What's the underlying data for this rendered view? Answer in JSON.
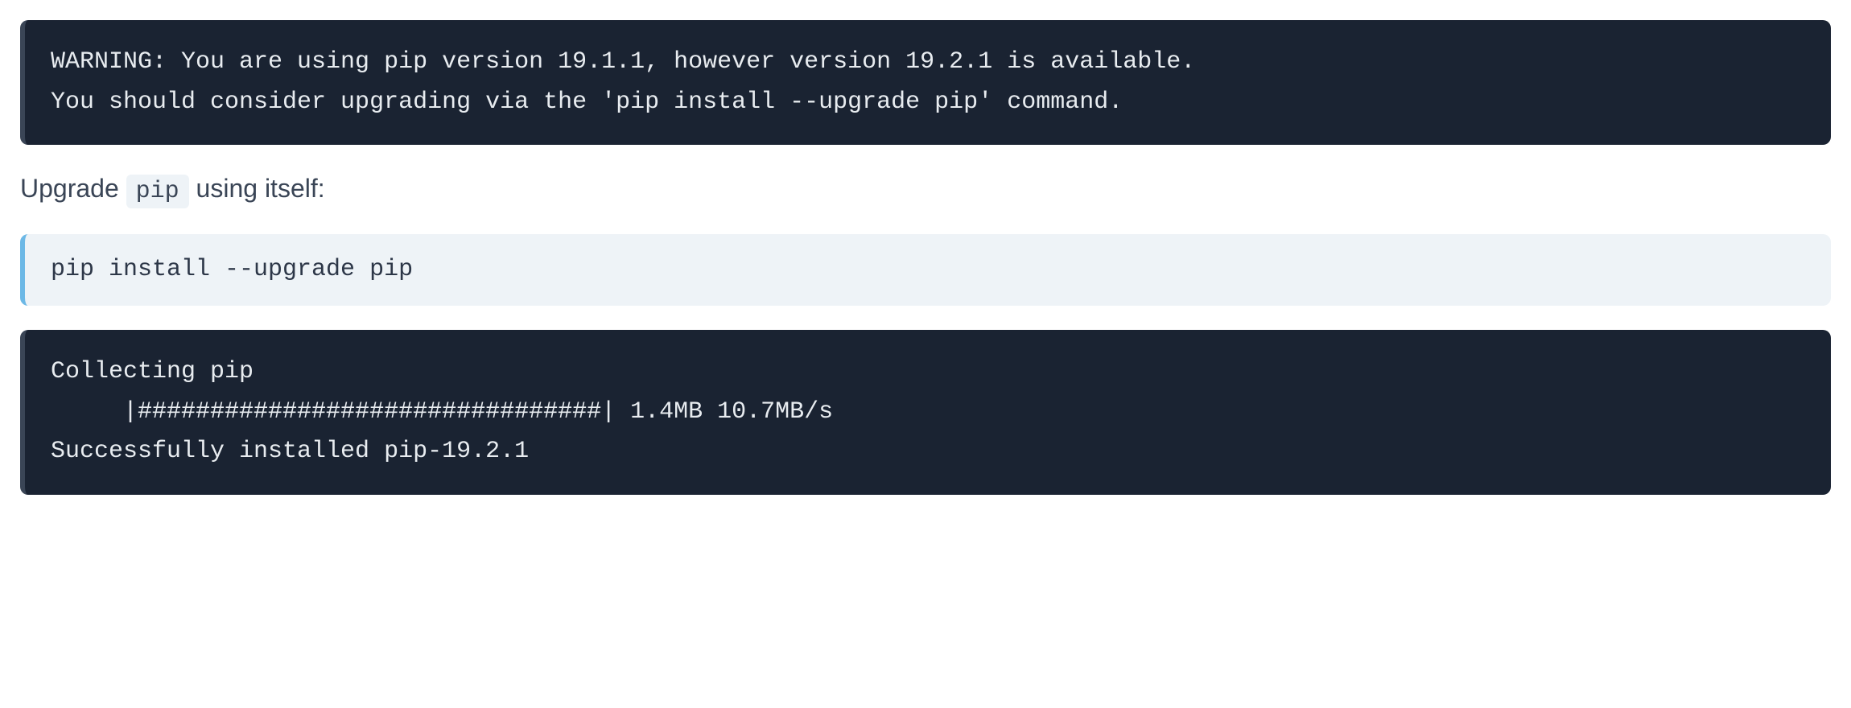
{
  "block1": "WARNING: You are using pip version 19.1.1, however version 19.2.1 is available.\nYou should consider upgrading via the 'pip install --upgrade pip' command.",
  "prose": {
    "part1": "Upgrade ",
    "code": "pip",
    "part2": " using itself:"
  },
  "block2": "pip install --upgrade pip",
  "block3": "Collecting pip\n     |################################| 1.4MB 10.7MB/s\nSuccessfully installed pip-19.2.1"
}
